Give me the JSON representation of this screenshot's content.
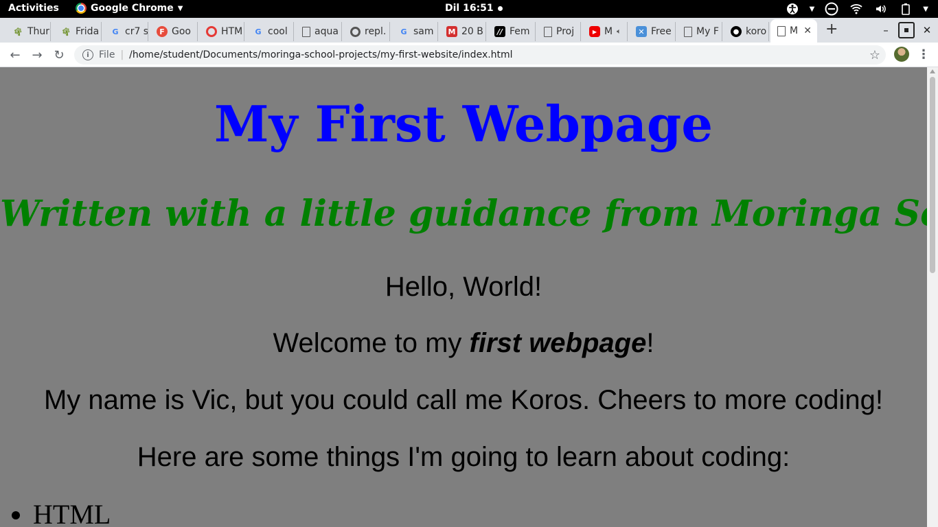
{
  "topbar": {
    "activities": "Activities",
    "app_name": "Google Chrome",
    "clock": "Dil 16:51"
  },
  "tabs": [
    {
      "label": "Thur",
      "icon": "tree-icon"
    },
    {
      "label": "Frida",
      "icon": "tree-icon"
    },
    {
      "label": "cr7 s",
      "icon": "google-icon"
    },
    {
      "label": "Goo",
      "icon": "f-icon"
    },
    {
      "label": "HTM",
      "icon": "red-ring-icon"
    },
    {
      "label": "cool",
      "icon": "google-icon"
    },
    {
      "label": "aqua",
      "icon": "doc-icon"
    },
    {
      "label": "repl.",
      "icon": "repl-icon"
    },
    {
      "label": "sam",
      "icon": "google-icon"
    },
    {
      "label": "20 B",
      "icon": "m-icon"
    },
    {
      "label": "Fem",
      "icon": "fem-icon"
    },
    {
      "label": "Proj",
      "icon": "doc-icon"
    },
    {
      "label": "M",
      "icon": "youtube-icon"
    },
    {
      "label": "Free",
      "icon": "x-icon"
    },
    {
      "label": "My F",
      "icon": "doc-icon"
    },
    {
      "label": "koro",
      "icon": "github-icon"
    },
    {
      "label": "M",
      "icon": "doc-icon"
    }
  ],
  "omnibox": {
    "scheme": "File",
    "url": "/home/student/Documents/moringa-school-projects/my-first-website/index.html"
  },
  "page": {
    "h1": "My First Webpage",
    "h2": "Written with a little guidance from Moringa School.",
    "p1": "Hello, World!",
    "p2_before": "Welcome to my ",
    "p2_em": "first webpage",
    "p2_after": "!",
    "p3": "My name is Vic, but you could call me Koros. Cheers to more coding!",
    "p4": "Here are some things I'm going to learn about coding:",
    "list": [
      "HTML"
    ]
  },
  "colors": {
    "page_bg": "#7f7f7f",
    "h1": "#0000ff",
    "h2": "#008000"
  }
}
